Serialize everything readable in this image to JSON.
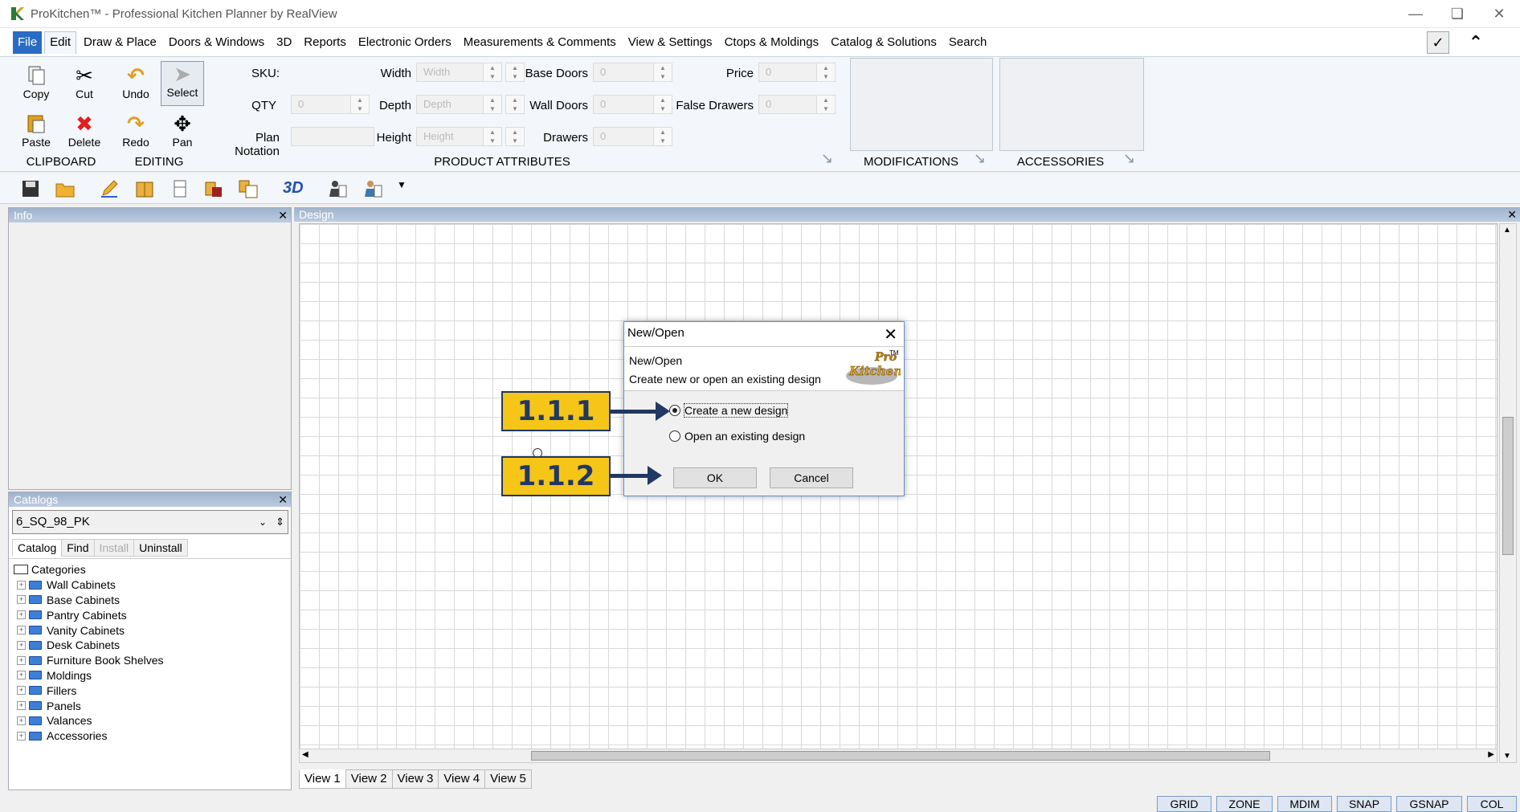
{
  "window": {
    "title": "ProKitchen™ - Professional Kitchen Planner by RealView"
  },
  "menu": {
    "items": [
      "File",
      "Edit",
      "Draw & Place",
      "Doors & Windows",
      "3D",
      "Reports",
      "Electronic Orders",
      "Measurements & Comments",
      "View & Settings",
      "Ctops & Moldings",
      "Catalog & Solutions",
      "Search"
    ],
    "active": "Edit"
  },
  "ribbon": {
    "clipboard": {
      "copy": "Copy",
      "cut": "Cut",
      "paste": "Paste",
      "delete": "Delete",
      "label": "CLIPBOARD"
    },
    "editing": {
      "undo": "Undo",
      "select": "Select",
      "redo": "Redo",
      "pan": "Pan",
      "label": "EDITING"
    },
    "attributes": {
      "sku_label": "SKU:",
      "qty_label": "QTY",
      "qty_value": "0",
      "plan_notation_label": "Plan Notation",
      "width_label": "Width",
      "width_placeholder": "Width",
      "depth_label": "Depth",
      "depth_placeholder": "Depth",
      "height_label": "Height",
      "height_placeholder": "Height",
      "base_doors_label": "Base Doors",
      "base_doors_value": "0",
      "wall_doors_label": "Wall Doors",
      "wall_doors_value": "0",
      "drawers_label": "Drawers",
      "drawers_value": "0",
      "price_label": "Price",
      "price_value": "0",
      "false_drawers_label": "False Drawers",
      "false_drawers_value": "0",
      "label": "PRODUCT ATTRIBUTES"
    },
    "modifications_label": "MODIFICATIONS",
    "accessories_label": "ACCESSORIES"
  },
  "toolbar": {
    "three_d_label": "3D"
  },
  "info_panel": {
    "title": "Info"
  },
  "catalog_panel": {
    "title": "Catalogs",
    "selected_catalog": "6_SQ_98_PK",
    "tabs": [
      "Catalog",
      "Find",
      "Install",
      "Uninstall"
    ],
    "root": "Categories",
    "categories": [
      "Wall Cabinets",
      "Base Cabinets",
      "Pantry Cabinets",
      "Vanity Cabinets",
      "Desk Cabinets",
      "Furniture Book Shelves",
      "Moldings",
      "Fillers",
      "Panels",
      "Valances",
      "Accessories"
    ]
  },
  "design_panel": {
    "title": "Design",
    "view_tabs": [
      "View 1",
      "View 2",
      "View 3",
      "View 4",
      "View 5"
    ],
    "active_view": "View 1"
  },
  "dialog": {
    "title": "New/Open",
    "header_title": "New/Open",
    "header_subtitle": "Create new or open an existing design",
    "logo_text_1": "Pro",
    "logo_text_2": "Kitchen",
    "logo_tm": "TM",
    "option_new": "Create a new design",
    "option_open": "Open an existing design",
    "selected_option": "new",
    "ok": "OK",
    "cancel": "Cancel"
  },
  "callouts": {
    "step1": "1.1.1",
    "step2": "1.1.2"
  },
  "statusbar": {
    "buttons": [
      "GRID",
      "ZONE",
      "MDIM",
      "SNAP",
      "GSNAP",
      "COL"
    ]
  },
  "colors": {
    "accent": "#2a6cc4",
    "callout_fill": "#f5c518",
    "callout_text": "#203864"
  }
}
